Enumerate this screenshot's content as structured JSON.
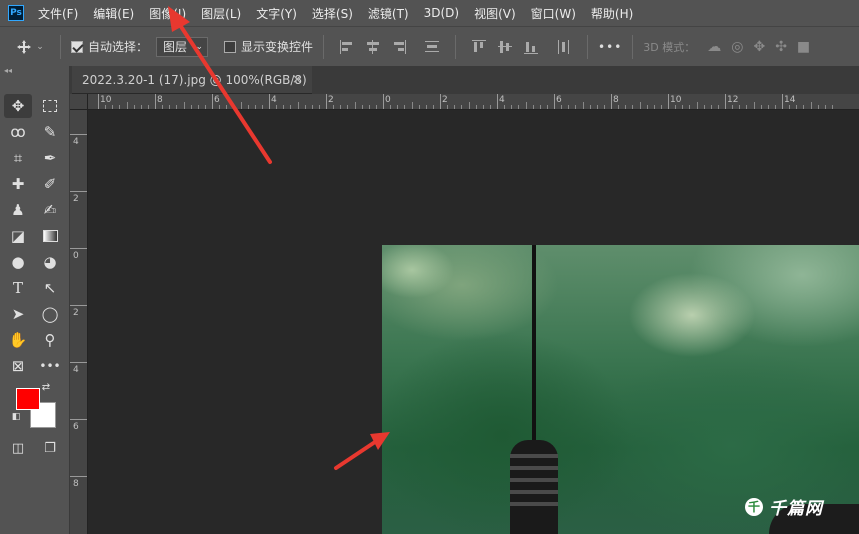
{
  "app": {
    "logo": "Ps"
  },
  "menu": [
    "文件(F)",
    "编辑(E)",
    "图像(I)",
    "图层(L)",
    "文字(Y)",
    "选择(S)",
    "滤镜(T)",
    "3D(D)",
    "视图(V)",
    "窗口(W)",
    "帮助(H)"
  ],
  "options": {
    "auto_select_label": "自动选择：",
    "auto_select_checked": true,
    "auto_select_value": "图层",
    "show_transform_label": "显示变换控件",
    "show_transform_checked": false,
    "more_label": "•••",
    "mode_3d_label": "3D 模式："
  },
  "document": {
    "tab_title": "2022.3.20-1 (17).jpg @ 100%(RGB/8)",
    "close_glyph": "×"
  },
  "ruler": {
    "top_labels": [
      "10",
      "8",
      "6",
      "4",
      "2",
      "0",
      "2",
      "4",
      "6",
      "8",
      "10",
      "12",
      "14"
    ],
    "left_labels": [
      "4",
      "2",
      "0",
      "2",
      "4",
      "6",
      "8"
    ]
  },
  "watermark": {
    "icon_glyph": "千",
    "text": "千篇网"
  },
  "colors": {
    "foreground": "#ff0000",
    "background": "#ffffff",
    "annotation_arrow": "#e8382f"
  },
  "tools": [
    "move-tool",
    "marquee-tool",
    "lasso-tool",
    "quick-select-tool",
    "crop-tool",
    "eyedropper-tool",
    "healing-brush-tool",
    "brush-tool",
    "clone-stamp-tool",
    "history-brush-tool",
    "eraser-tool",
    "gradient-tool",
    "blur-tool",
    "dodge-tool",
    "type-tool",
    "path-select-tool",
    "direct-select-tool",
    "ellipse-tool",
    "hand-tool",
    "zoom-tool",
    "frame-tool",
    "more-tools",
    "swap-colors",
    "quick-mask-tool",
    "screen-mode-tool"
  ]
}
